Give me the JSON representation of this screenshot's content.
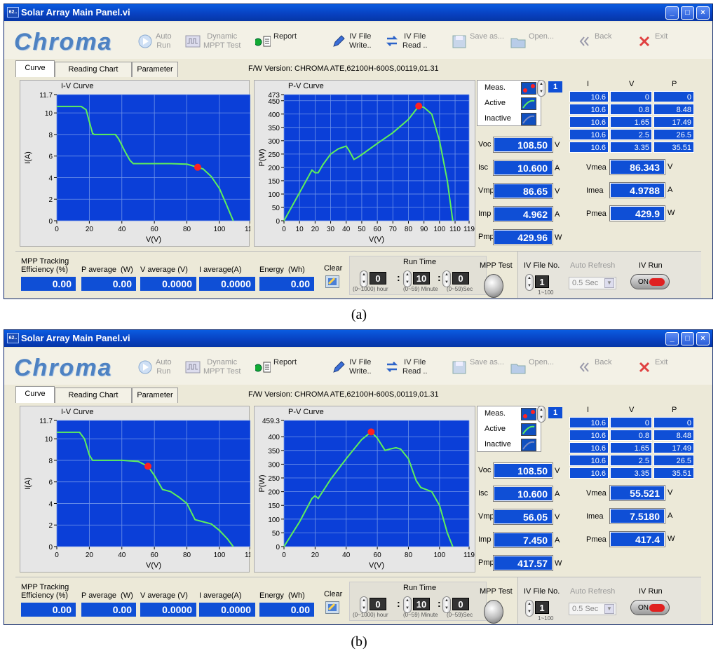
{
  "panels": [
    {
      "window_title": "Solar Array Main Panel.vi",
      "title_icon_text": "62..",
      "window_buttons": [
        "_",
        "□",
        "×"
      ],
      "logo": "Chroma",
      "toolbar": [
        {
          "label": "Auto\nRun",
          "icon": "play-icon",
          "enabled": false
        },
        {
          "label": "Dynamic\nMPPT Test",
          "icon": "waveform-icon",
          "enabled": false
        },
        {
          "label": "Report",
          "icon": "report-icon",
          "enabled": true
        },
        {
          "label": "IV File\nWrite..",
          "icon": "pencil-icon",
          "enabled": true
        },
        {
          "label": "IV File\nRead ..",
          "icon": "swap-arrows-icon",
          "enabled": true
        },
        {
          "label": "Save as...",
          "icon": "floppy-icon",
          "enabled": false
        },
        {
          "label": "Open...",
          "icon": "folder-icon",
          "enabled": false
        },
        {
          "label": "Back",
          "icon": "double-chevron-left-icon",
          "enabled": false
        },
        {
          "label": "Exit",
          "icon": "close-x-icon",
          "enabled": false
        }
      ],
      "tabs": [
        "Curve",
        "Reading Chart",
        "Parameter"
      ],
      "active_tab": "Curve",
      "firmware": "F/W Version: CHROMA ATE,62100H-600S,00119,01.31",
      "iv_chart": {
        "title": "I-V Curve",
        "xlabel": "V(V)",
        "ylabel": "I(A)",
        "ymax_label": "11.7",
        "yticks": [
          "10",
          "8",
          "6",
          "4",
          "2",
          "0"
        ],
        "xticks": [
          "0",
          "20",
          "40",
          "60",
          "80",
          "100",
          "119"
        ]
      },
      "pv_chart": {
        "title": "P-V Curve",
        "xlabel": "V(V)",
        "ylabel": "P(W)",
        "ymax_label": "473",
        "yticks": [
          "450",
          "400",
          "350",
          "300",
          "250",
          "200",
          "150",
          "100",
          "50",
          "0"
        ],
        "xticks": [
          "0",
          "10",
          "20",
          "30",
          "40",
          "50",
          "60",
          "70",
          "80",
          "90",
          "100",
          "110",
          "119"
        ]
      },
      "legend": {
        "meas": "Meas.",
        "active": "Active",
        "inactive": "Inactive",
        "index": "1"
      },
      "readings": [
        {
          "label": "Voc",
          "value": "108.50",
          "unit": "V"
        },
        {
          "label": "Isc",
          "value": "10.600",
          "unit": "A"
        },
        {
          "label": "Vmp",
          "value": "86.65",
          "unit": "V"
        },
        {
          "label": "Imp",
          "value": "4.962",
          "unit": "A"
        },
        {
          "label": "Pmp",
          "value": "429.96",
          "unit": "W"
        }
      ],
      "table_headers": [
        "I",
        "V",
        "P"
      ],
      "table_rows": [
        [
          "10.6",
          "0",
          "0"
        ],
        [
          "10.6",
          "0.8",
          "8.48"
        ],
        [
          "10.6",
          "1.65",
          "17.49"
        ],
        [
          "10.6",
          "2.5",
          "26.5"
        ],
        [
          "10.6",
          "3.35",
          "35.51"
        ]
      ],
      "meas": [
        {
          "label": "Vmea",
          "value": "86.343",
          "unit": "V"
        },
        {
          "label": "Imea",
          "value": "4.9788",
          "unit": "A"
        },
        {
          "label": "Pmea",
          "value": "429.9",
          "unit": "W"
        }
      ],
      "bottom": {
        "mpp_label": "MPP Tracking\nEfficiency (%)",
        "mpp_value": "0.00",
        "pavg_label": "P average  (W)",
        "pavg_value": "0.00",
        "vavg_label": "V average (V)",
        "vavg_value": "0.0000",
        "iavg_label": "I average(A)",
        "iavg_value": "0.0000",
        "energy_label": "Energy  (Wh)",
        "energy_value": "0.00",
        "clear": "Clear",
        "runtime": "Run Time",
        "hour": "0",
        "minute": "10",
        "sec": "0",
        "hour_range": "(0~1000) hour",
        "minute_range": "(0~59) Minute",
        "sec_range": "(0~59)Sec",
        "mppt_test": "MPP Test",
        "ivfile_label": "IV File No.",
        "ivfile_value": "1",
        "ivfile_range": "1~100",
        "autorefresh": "Auto Refresh",
        "autorefresh_value": "0.5 Sec",
        "ivrun": "IV Run",
        "on": "ON"
      },
      "chart_data": {
        "iv_curve": {
          "type": "line",
          "xlabel": "V(V)",
          "ylabel": "I(A)",
          "xlim": [
            0,
            119
          ],
          "ylim": [
            0,
            11.7
          ],
          "x": [
            0,
            15,
            18,
            20,
            22,
            23,
            36,
            38,
            42,
            45,
            47,
            55,
            70,
            80,
            86.65,
            90,
            95,
            100,
            104,
            108.5
          ],
          "y": [
            10.6,
            10.6,
            10.3,
            9.2,
            8.1,
            8.0,
            8.0,
            7.6,
            6.4,
            5.6,
            5.3,
            5.3,
            5.3,
            5.25,
            4.962,
            4.8,
            4.1,
            3.0,
            1.6,
            0
          ],
          "marker": {
            "x": 86.65,
            "y": 4.962
          }
        },
        "pv_curve": {
          "type": "line",
          "xlabel": "V(V)",
          "ylabel": "P(W)",
          "xlim": [
            0,
            119
          ],
          "ylim": [
            0,
            473
          ],
          "x": [
            0,
            10,
            18,
            20,
            22,
            25,
            30,
            35,
            40,
            42,
            45,
            48,
            50,
            60,
            70,
            80,
            86.65,
            90,
            95,
            100,
            105,
            108.5
          ],
          "y": [
            0,
            105,
            190,
            180,
            180,
            210,
            250,
            270,
            280,
            262,
            230,
            240,
            248,
            290,
            330,
            380,
            429.96,
            425,
            400,
            300,
            150,
            0
          ],
          "marker": {
            "x": 86.65,
            "y": 429.96
          }
        }
      }
    },
    {
      "window_title": "Solar Array Main Panel.vi",
      "title_icon_text": "62..",
      "window_buttons": [
        "_",
        "□",
        "×"
      ],
      "logo": "Chroma",
      "toolbar": [
        {
          "label": "Auto\nRun",
          "icon": "play-icon",
          "enabled": false
        },
        {
          "label": "Dynamic\nMPPT Test",
          "icon": "waveform-icon",
          "enabled": false
        },
        {
          "label": "Report",
          "icon": "report-icon",
          "enabled": true
        },
        {
          "label": "IV File\nWrite..",
          "icon": "pencil-icon",
          "enabled": true
        },
        {
          "label": "IV File\nRead ..",
          "icon": "swap-arrows-icon",
          "enabled": true
        },
        {
          "label": "Save as...",
          "icon": "floppy-icon",
          "enabled": false
        },
        {
          "label": "Open...",
          "icon": "folder-icon",
          "enabled": false
        },
        {
          "label": "Back",
          "icon": "double-chevron-left-icon",
          "enabled": false
        },
        {
          "label": "Exit",
          "icon": "close-x-icon",
          "enabled": false
        }
      ],
      "tabs": [
        "Curve",
        "Reading Chart",
        "Parameter"
      ],
      "active_tab": "Curve",
      "firmware": "F/W Version: CHROMA ATE,62100H-600S,00119,01.31",
      "iv_chart": {
        "title": "I-V Curve",
        "xlabel": "V(V)",
        "ylabel": "I(A)",
        "ymax_label": "11.7",
        "yticks": [
          "10",
          "8",
          "6",
          "4",
          "2",
          "0"
        ],
        "xticks": [
          "0",
          "20",
          "40",
          "60",
          "80",
          "100",
          "119"
        ]
      },
      "pv_chart": {
        "title": "P-V Curve",
        "xlabel": "V(V)",
        "ylabel": "P(W)",
        "ymax_label": "459.3",
        "yticks": [
          "400",
          "350",
          "300",
          "250",
          "200",
          "150",
          "100",
          "50",
          "0"
        ],
        "xticks": [
          "0",
          "20",
          "40",
          "60",
          "80",
          "100",
          "119"
        ]
      },
      "legend": {
        "meas": "Meas.",
        "active": "Active",
        "inactive": "Inactive",
        "index": "1"
      },
      "readings": [
        {
          "label": "Voc",
          "value": "108.50",
          "unit": "V"
        },
        {
          "label": "Isc",
          "value": "10.600",
          "unit": "A"
        },
        {
          "label": "Vmp",
          "value": "56.05",
          "unit": "V"
        },
        {
          "label": "Imp",
          "value": "7.450",
          "unit": "A"
        },
        {
          "label": "Pmp",
          "value": "417.57",
          "unit": "W"
        }
      ],
      "table_headers": [
        "I",
        "V",
        "P"
      ],
      "table_rows": [
        [
          "10.6",
          "0",
          "0"
        ],
        [
          "10.6",
          "0.8",
          "8.48"
        ],
        [
          "10.6",
          "1.65",
          "17.49"
        ],
        [
          "10.6",
          "2.5",
          "26.5"
        ],
        [
          "10.6",
          "3.35",
          "35.51"
        ]
      ],
      "meas": [
        {
          "label": "Vmea",
          "value": "55.521",
          "unit": "V"
        },
        {
          "label": "Imea",
          "value": "7.5180",
          "unit": "A"
        },
        {
          "label": "Pmea",
          "value": "417.4",
          "unit": "W"
        }
      ],
      "bottom": {
        "mpp_label": "MPP Tracking\nEfficiency (%)",
        "mpp_value": "0.00",
        "pavg_label": "P average  (W)",
        "pavg_value": "0.00",
        "vavg_label": "V average (V)",
        "vavg_value": "0.0000",
        "iavg_label": "I average(A)",
        "iavg_value": "0.0000",
        "energy_label": "Energy  (Wh)",
        "energy_value": "0.00",
        "clear": "Clear",
        "runtime": "Run Time",
        "hour": "0",
        "minute": "10",
        "sec": "0",
        "hour_range": "(0~1000) hour",
        "minute_range": "(0~59) Minute",
        "sec_range": "(0~59)Sec",
        "mppt_test": "MPP Test",
        "ivfile_label": "IV File No.",
        "ivfile_value": "1",
        "ivfile_range": "1~100",
        "autorefresh": "Auto Refresh",
        "autorefresh_value": "0.5 Sec",
        "ivrun": "IV Run",
        "on": "ON"
      },
      "chart_data": {
        "iv_curve": {
          "type": "line",
          "xlabel": "V(V)",
          "ylabel": "I(A)",
          "xlim": [
            0,
            119
          ],
          "ylim": [
            0,
            11.7
          ],
          "x": [
            0,
            14,
            17,
            20,
            22,
            40,
            50,
            56.05,
            60,
            65,
            70,
            75,
            80,
            85,
            90,
            95,
            100,
            105,
            108.5
          ],
          "y": [
            10.6,
            10.6,
            10.0,
            8.5,
            8.0,
            8.0,
            7.9,
            7.45,
            6.6,
            5.3,
            5.1,
            4.6,
            4.0,
            2.5,
            2.3,
            2.1,
            1.5,
            0.7,
            0
          ],
          "marker": {
            "x": 56.05,
            "y": 7.45
          }
        },
        "pv_curve": {
          "type": "line",
          "xlabel": "V(V)",
          "ylabel": "P(W)",
          "xlim": [
            0,
            119
          ],
          "ylim": [
            0,
            459.3
          ],
          "x": [
            0,
            10,
            18,
            20,
            22,
            30,
            40,
            50,
            56.05,
            60,
            65,
            68,
            72,
            75,
            80,
            85,
            88,
            95,
            100,
            105,
            108.5
          ],
          "y": [
            0,
            90,
            175,
            185,
            175,
            245,
            320,
            390,
            417.57,
            395,
            350,
            355,
            360,
            355,
            320,
            240,
            215,
            200,
            150,
            50,
            0
          ],
          "marker": {
            "x": 56.05,
            "y": 417.57
          }
        }
      }
    }
  ],
  "captions": [
    "(a)",
    "(b)"
  ]
}
